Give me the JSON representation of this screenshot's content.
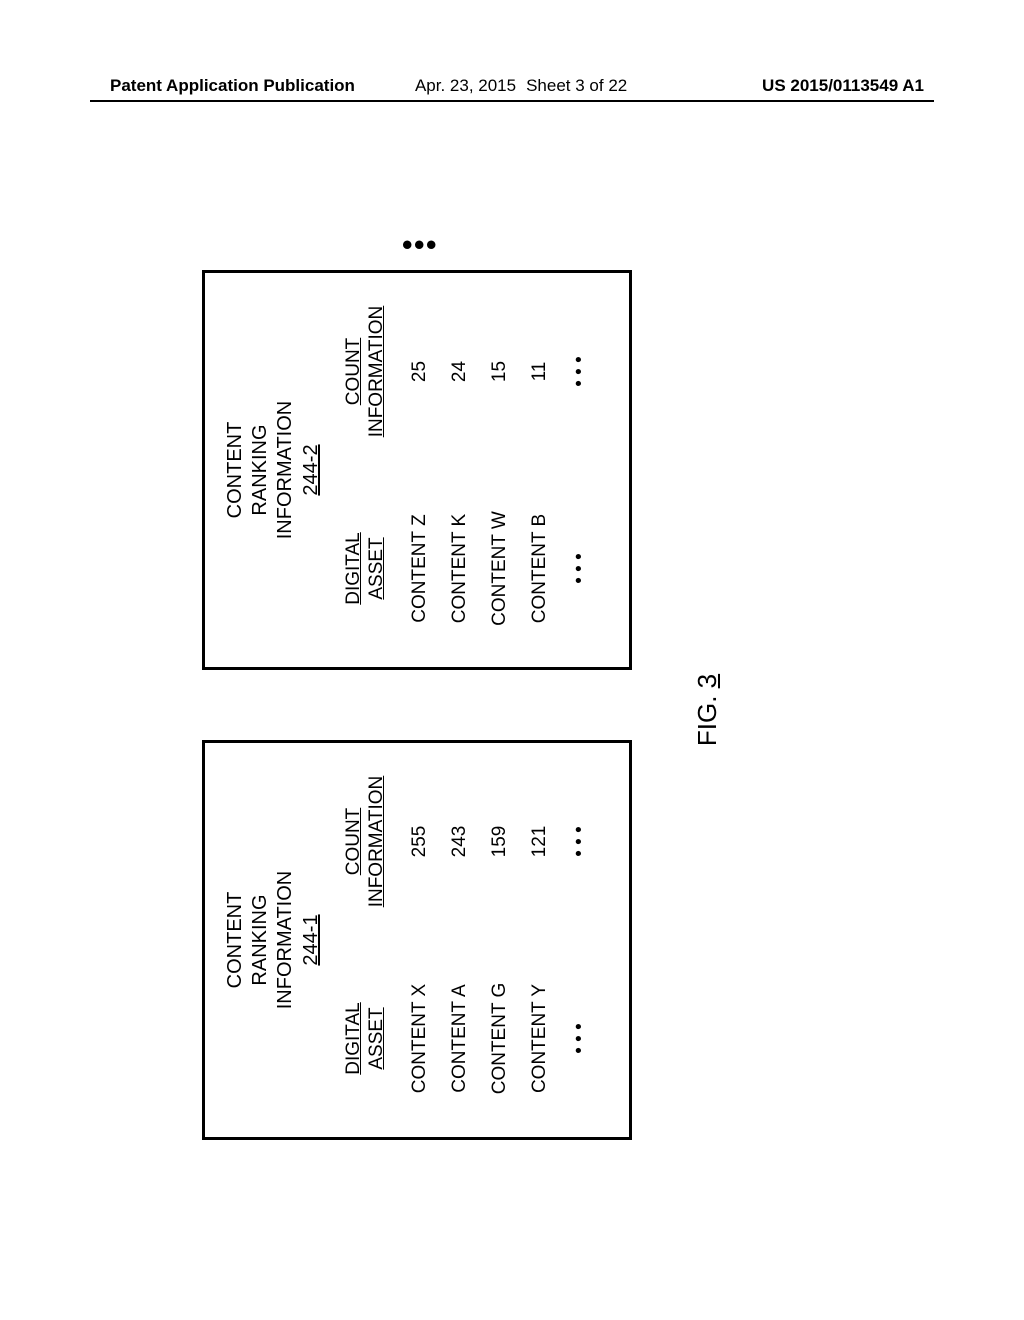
{
  "header": {
    "pubtitle": "Patent Application Publication",
    "date": "Apr. 23, 2015",
    "sheet": "Sheet 3 of 22",
    "pubno": "US 2015/0113549 A1"
  },
  "figure": {
    "label_prefix": "FIG.",
    "label_no": "3"
  },
  "panels": {
    "a": {
      "title_l1": "CONTENT",
      "title_l2": "RANKING",
      "title_l3": "INFORMATION",
      "ref": "244-1",
      "colhdr_asset_l1": "DIGITAL",
      "colhdr_asset_l2": "ASSET",
      "colhdr_count_l1": "COUNT",
      "colhdr_count_l2": "INFORMATION",
      "rows": [
        {
          "asset": "CONTENT X",
          "count": "255"
        },
        {
          "asset": "CONTENT A",
          "count": "243"
        },
        {
          "asset": "CONTENT G",
          "count": "159"
        },
        {
          "asset": "CONTENT Y",
          "count": "121"
        },
        {
          "asset": "• • •",
          "count": "• • •"
        }
      ]
    },
    "b": {
      "title_l1": "CONTENT",
      "title_l2": "RANKING",
      "title_l3": "INFORMATION",
      "ref": "244-2",
      "colhdr_asset_l1": "DIGITAL",
      "colhdr_asset_l2": "ASSET",
      "colhdr_count_l1": "COUNT",
      "colhdr_count_l2": "INFORMATION",
      "rows": [
        {
          "asset": "CONTENT Z",
          "count": "25"
        },
        {
          "asset": "CONTENT K",
          "count": "24"
        },
        {
          "asset": "CONTENT W",
          "count": "15"
        },
        {
          "asset": "CONTENT B",
          "count": "11"
        },
        {
          "asset": "• • •",
          "count": "• • •"
        }
      ]
    }
  },
  "ellipsis_dots": [
    "•",
    "•",
    "•"
  ],
  "chart_data": [
    {
      "type": "table",
      "title": "CONTENT RANKING INFORMATION 244-1",
      "columns": [
        "DIGITAL ASSET",
        "COUNT INFORMATION"
      ],
      "rows": [
        [
          "CONTENT X",
          255
        ],
        [
          "CONTENT A",
          243
        ],
        [
          "CONTENT G",
          159
        ],
        [
          "CONTENT Y",
          121
        ]
      ]
    },
    {
      "type": "table",
      "title": "CONTENT RANKING INFORMATION 244-2",
      "columns": [
        "DIGITAL ASSET",
        "COUNT INFORMATION"
      ],
      "rows": [
        [
          "CONTENT Z",
          25
        ],
        [
          "CONTENT K",
          24
        ],
        [
          "CONTENT W",
          15
        ],
        [
          "CONTENT B",
          11
        ]
      ]
    }
  ]
}
